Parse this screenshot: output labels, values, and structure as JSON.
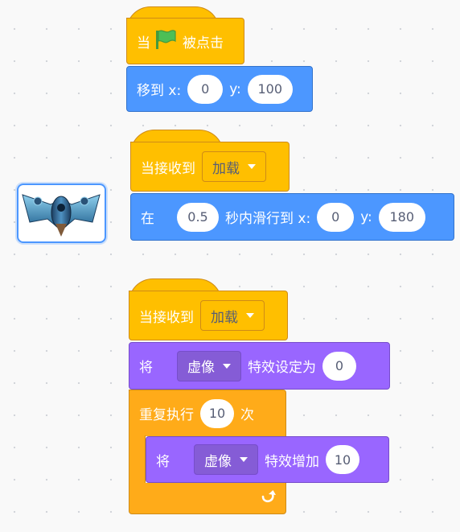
{
  "script1": {
    "hat": {
      "when": "当",
      "clicked": "被点击",
      "flag_icon": "green-flag-icon"
    },
    "goto": {
      "label": "移到 x:",
      "x": "0",
      "y_label": "y:",
      "y": "100"
    }
  },
  "script2": {
    "hat": {
      "label": "当接收到",
      "message": "加载"
    },
    "glide": {
      "in": "在",
      "secs": "0.5",
      "secs_label": "秒内滑行到 x:",
      "x": "0",
      "y_label": "y:",
      "y": "180"
    }
  },
  "script3": {
    "hat": {
      "label": "当接收到",
      "message": "加载"
    },
    "set_effect": {
      "label": "将",
      "effect": "虚像",
      "suffix": "特效设定为",
      "value": "0"
    },
    "repeat": {
      "label": "重复执行",
      "times": "10",
      "suffix": "次",
      "loop_icon": "loop-arrow-icon"
    },
    "change_effect": {
      "label": "将",
      "effect": "虚像",
      "suffix": "特效增加",
      "value": "10"
    }
  },
  "sprite": {
    "icon": "spaceship-sprite-icon"
  },
  "colors": {
    "events": "#ffbf00",
    "motion": "#4c97ff",
    "looks": "#9966ff",
    "control": "#ffab19",
    "flag": "#4cbf56"
  }
}
